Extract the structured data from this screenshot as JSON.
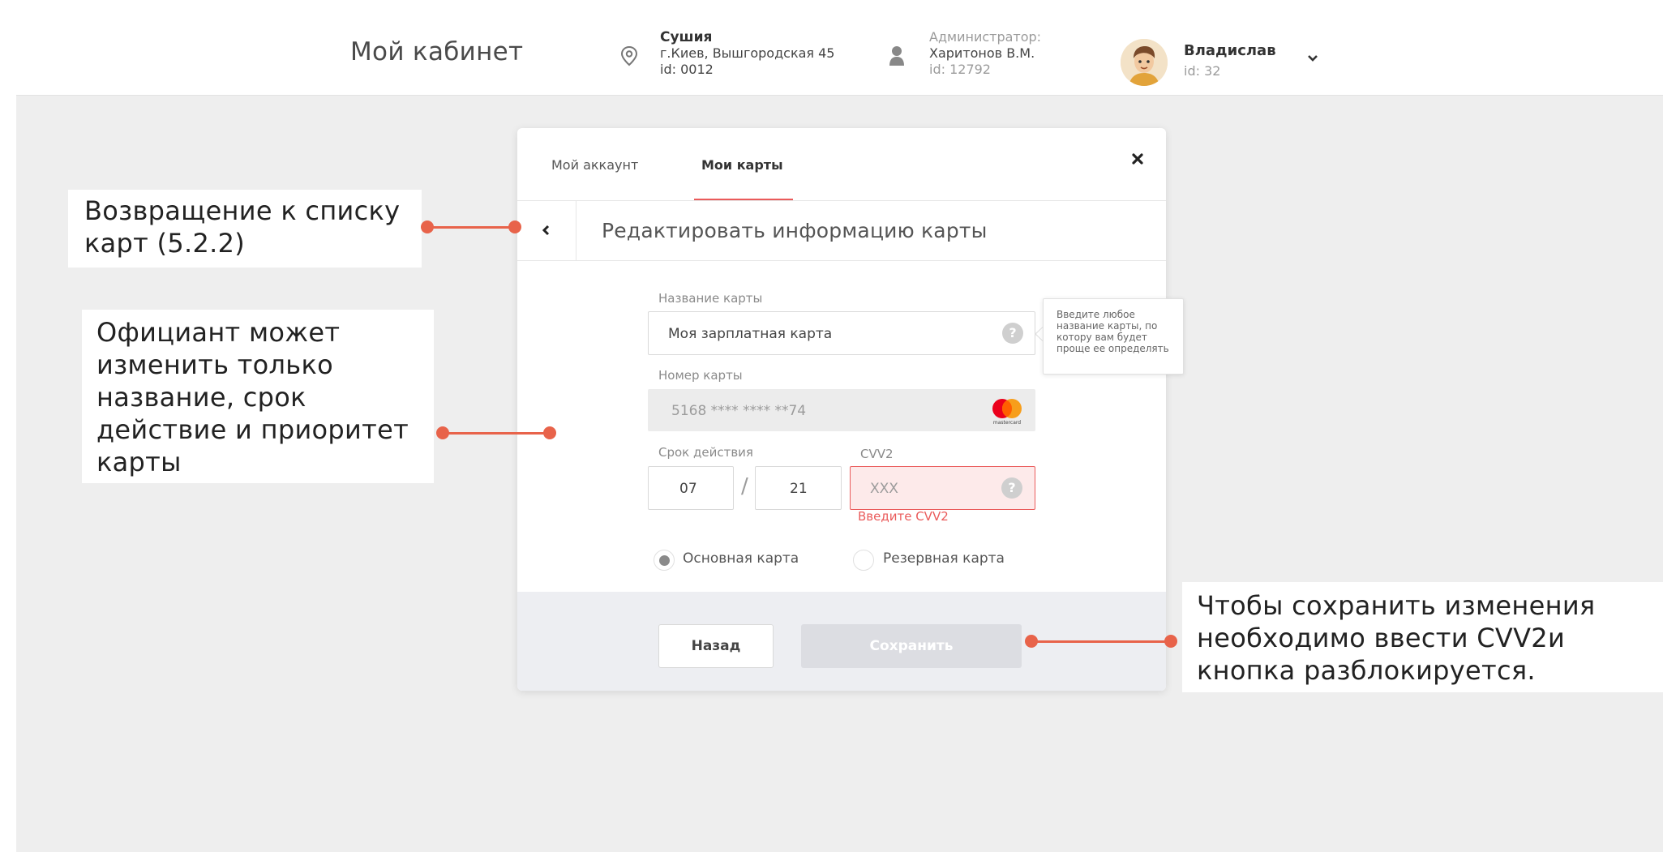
{
  "header": {
    "title": "Мой кабинет",
    "venue": {
      "name": "Сушия",
      "address": "г.Киев, Вышгородская 45",
      "id": "id: 0012",
      "icon": "location-pin-icon"
    },
    "admin": {
      "role": "Администратор:",
      "name": "Харитонов В.М.",
      "id": "id: 12792",
      "icon": "person-icon"
    },
    "user": {
      "name": "Владислав",
      "id": "id: 32",
      "icon": "chevron-down-icon"
    }
  },
  "modal": {
    "tabs": [
      {
        "label": "Мой аккаунт",
        "active": false
      },
      {
        "label": "Мои карты",
        "active": true
      }
    ],
    "section_title": "Редактировать информацию карты",
    "card_name": {
      "label": "Название карты",
      "value": "Моя зарплатная карта",
      "help": "?"
    },
    "tooltip": "Введите любое название карты, по котору вам будет проще ее определять",
    "card_number": {
      "label": "Номер карты",
      "value": "5168  **** **** **74",
      "brand": "mastercard"
    },
    "expiry": {
      "label": "Срок действия",
      "month": "07",
      "separator": "/",
      "year": "21"
    },
    "cvv": {
      "label": "CVV2",
      "placeholder": "XXX",
      "error": "Введите CVV2",
      "help": "?"
    },
    "priority": [
      {
        "label": "Основная карта",
        "checked": true
      },
      {
        "label": "Резервная карта",
        "checked": false
      }
    ],
    "buttons": {
      "back": "Назад",
      "save": "Сохранить"
    }
  },
  "annotations": {
    "back_to_list": "Возвращение к списку карт (5.2.2)",
    "editable_fields": "Официант может изменить только название, срок действие и приоритет карты",
    "save_unlock": "Чтобы сохранить изменения необходимо ввести CVV2и кнопка разблокируется."
  },
  "colors": {
    "accent": "#ea5b5b",
    "connector": "#e8634a",
    "background": "#eeeeee"
  }
}
